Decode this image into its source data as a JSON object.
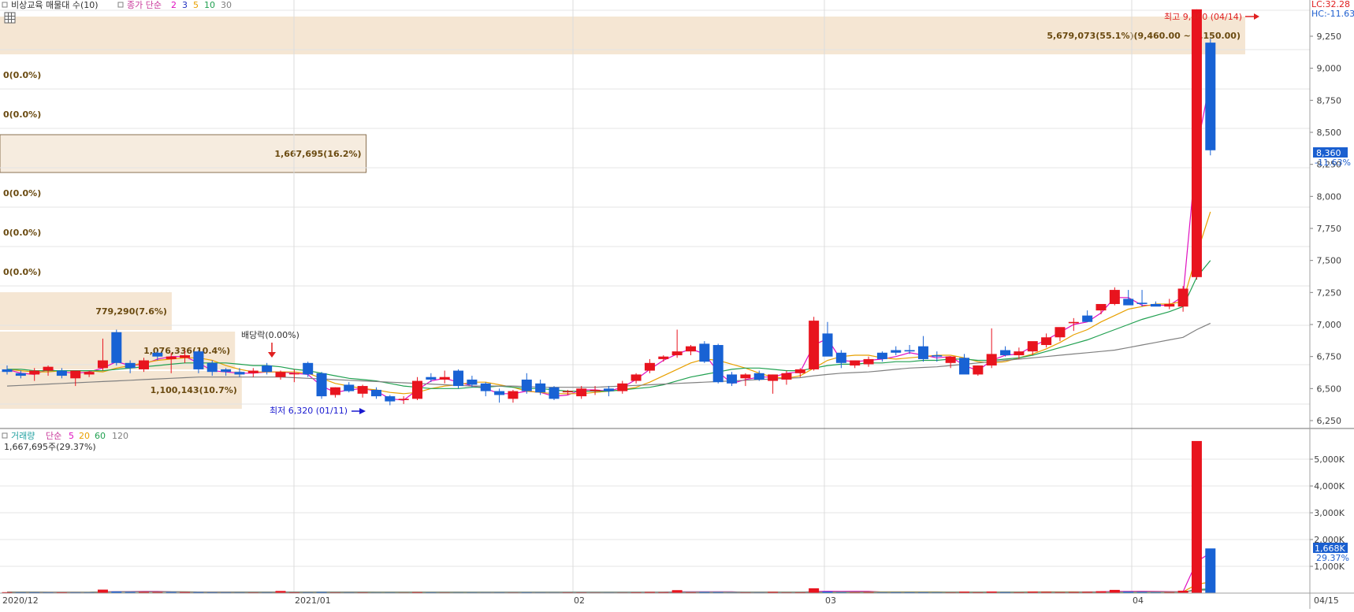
{
  "header": {
    "menu_label": "비상교육 매물대 수(10)",
    "ma_label": "종가 단순",
    "ma_periods": [
      "2",
      "3",
      "5",
      "10",
      "30"
    ],
    "ma_colors": [
      "#e010c0",
      "#2030c0",
      "#e8a000",
      "#20a050",
      "#808080"
    ]
  },
  "top_right": {
    "lc": "LC:32.28",
    "hc": "HC:-11.63"
  },
  "price_axis": {
    "ticks": [
      "9,250",
      "9,000",
      "8,750",
      "8,500",
      "8,250",
      "8,000",
      "7,750",
      "7,500",
      "7,250",
      "7,000",
      "6,750",
      "6,500",
      "6,250"
    ]
  },
  "price_tag": {
    "value": "8,360",
    "change": "-11.63%"
  },
  "volume_profile": {
    "labels": [
      "5,679,073(55.1%)(9,460.00 ~ 9,150.00)",
      "0(0.0%)",
      "0(0.0%)",
      "1,667,695(16.2%)",
      "0(0.0%)",
      "0(0.0%)",
      "0(0.0%)",
      "779,290(7.6%)",
      "1,076,336(10.4%)",
      "1,100,143(10.7%)"
    ],
    "fractions": [
      0.551,
      0,
      0,
      0.162,
      0,
      0,
      0,
      0.076,
      0.104,
      0.107
    ],
    "color": "#f5e6d3"
  },
  "annotations": {
    "high": "최고 9,460 (04/14)",
    "low": "최저 6,320 (01/11)",
    "dividend": "배당락(0.00%)"
  },
  "volume_panel": {
    "title": "거래량",
    "ma_label": "단순",
    "ma_periods": [
      "5",
      "20",
      "60",
      "120"
    ],
    "ma_colors": [
      "#e010c0",
      "#e8a000",
      "#20a050",
      "#808080"
    ],
    "info": "1,667,695주(29.37%)",
    "axis_ticks": [
      "5,000K",
      "4,000K",
      "3,000K",
      "2,000K",
      "1,000K"
    ],
    "tag_value": "1,668K",
    "tag_pct": "29.37%"
  },
  "x_axis": {
    "labels": [
      "2020/12",
      "2021/01",
      "02",
      "03",
      "04",
      "04/15"
    ]
  },
  "chart_data": {
    "type": "candlestick",
    "title": "비상교육",
    "y_axis": {
      "ylim": [
        6200,
        9500
      ],
      "ticks": [
        9250,
        9000,
        8750,
        8500,
        8250,
        8000,
        7750,
        7500,
        7250,
        7000,
        6750,
        6500,
        6250
      ]
    },
    "high_point": {
      "date": "04/14",
      "value": 9460
    },
    "low_point": {
      "date": "01/11",
      "value": 6320
    },
    "last": {
      "date": "04/15",
      "close": 8360,
      "change_pct": -11.63
    },
    "candles": [
      [
        6650,
        6680,
        6610,
        6630
      ],
      [
        6620,
        6640,
        6580,
        6600
      ],
      [
        6610,
        6660,
        6560,
        6640
      ],
      [
        6640,
        6680,
        6600,
        6670
      ],
      [
        6640,
        6660,
        6580,
        6600
      ],
      [
        6580,
        6610,
        6520,
        6640
      ],
      [
        6610,
        6640,
        6590,
        6630
      ],
      [
        6660,
        6890,
        6640,
        6720
      ],
      [
        6940,
        6960,
        6680,
        6700
      ],
      [
        6700,
        6720,
        6620,
        6660
      ],
      [
        6650,
        6740,
        6630,
        6720
      ],
      [
        6780,
        6790,
        6720,
        6750
      ],
      [
        6730,
        6780,
        6620,
        6750
      ],
      [
        6740,
        6800,
        6700,
        6760
      ],
      [
        6790,
        6800,
        6620,
        6650
      ],
      [
        6700,
        6720,
        6600,
        6630
      ],
      [
        6650,
        6660,
        6600,
        6630
      ],
      [
        6630,
        6660,
        6590,
        6610
      ],
      [
        6620,
        6660,
        6590,
        6640
      ],
      [
        6680,
        6700,
        6610,
        6630
      ],
      [
        6590,
        6640,
        6570,
        6630
      ],
      [
        6620,
        6650,
        6550,
        6620
      ],
      [
        6700,
        6710,
        6590,
        6610
      ],
      [
        6620,
        6630,
        6420,
        6440
      ],
      [
        6450,
        6510,
        6430,
        6510
      ],
      [
        6530,
        6550,
        6470,
        6480
      ],
      [
        6460,
        6530,
        6430,
        6520
      ],
      [
        6490,
        6510,
        6420,
        6440
      ],
      [
        6440,
        6450,
        6370,
        6400
      ],
      [
        6410,
        6440,
        6380,
        6420
      ],
      [
        6420,
        6590,
        6410,
        6560
      ],
      [
        6590,
        6620,
        6550,
        6570
      ],
      [
        6570,
        6640,
        6540,
        6590
      ],
      [
        6640,
        6650,
        6500,
        6520
      ],
      [
        6570,
        6600,
        6510,
        6530
      ],
      [
        6540,
        6550,
        6440,
        6480
      ],
      [
        6480,
        6500,
        6390,
        6450
      ],
      [
        6420,
        6490,
        6390,
        6480
      ],
      [
        6570,
        6620,
        6460,
        6480
      ],
      [
        6540,
        6570,
        6450,
        6470
      ],
      [
        6510,
        6520,
        6410,
        6420
      ],
      [
        6480,
        6490,
        6450,
        6480
      ],
      [
        6440,
        6520,
        6420,
        6500
      ],
      [
        6480,
        6520,
        6450,
        6490
      ],
      [
        6500,
        6520,
        6440,
        6480
      ],
      [
        6480,
        6560,
        6460,
        6540
      ],
      [
        6560,
        6620,
        6540,
        6610
      ],
      [
        6640,
        6730,
        6620,
        6700
      ],
      [
        6730,
        6760,
        6710,
        6750
      ],
      [
        6760,
        6960,
        6740,
        6790
      ],
      [
        6790,
        6840,
        6760,
        6830
      ],
      [
        6850,
        6870,
        6700,
        6710
      ],
      [
        6840,
        6850,
        6540,
        6550
      ],
      [
        6610,
        6630,
        6520,
        6540
      ],
      [
        6580,
        6620,
        6520,
        6610
      ],
      [
        6620,
        6640,
        6560,
        6570
      ],
      [
        6560,
        6610,
        6460,
        6610
      ],
      [
        6570,
        6640,
        6530,
        6620
      ],
      [
        6620,
        6660,
        6590,
        6650
      ],
      [
        6650,
        7060,
        6640,
        7030
      ],
      [
        6930,
        7020,
        6770,
        6750
      ],
      [
        6780,
        6800,
        6660,
        6700
      ],
      [
        6680,
        6720,
        6660,
        6720
      ],
      [
        6690,
        6750,
        6670,
        6730
      ],
      [
        6780,
        6790,
        6710,
        6730
      ],
      [
        6800,
        6830,
        6760,
        6780
      ],
      [
        6800,
        6840,
        6770,
        6790
      ],
      [
        6830,
        6910,
        6710,
        6730
      ],
      [
        6760,
        6790,
        6710,
        6750
      ],
      [
        6700,
        6740,
        6660,
        6750
      ],
      [
        6740,
        6770,
        6630,
        6610
      ],
      [
        6610,
        6680,
        6600,
        6680
      ],
      [
        6680,
        6970,
        6660,
        6770
      ],
      [
        6800,
        6830,
        6750,
        6760
      ],
      [
        6760,
        6820,
        6730,
        6790
      ],
      [
        6790,
        6850,
        6760,
        6870
      ],
      [
        6840,
        6930,
        6820,
        6900
      ],
      [
        6900,
        6940,
        6870,
        6980
      ],
      [
        7010,
        7050,
        6950,
        7020
      ],
      [
        7070,
        7110,
        7060,
        7020
      ],
      [
        7110,
        7150,
        7080,
        7160
      ],
      [
        7160,
        7290,
        7150,
        7270
      ],
      [
        7200,
        7270,
        7170,
        7150
      ],
      [
        7170,
        7270,
        7140,
        7160
      ],
      [
        7160,
        7180,
        7150,
        7140
      ],
      [
        7140,
        7200,
        7120,
        7160
      ],
      [
        7140,
        7300,
        7100,
        7280
      ],
      [
        7370,
        9460,
        7350,
        9460
      ],
      [
        9200,
        9230,
        8320,
        8360
      ]
    ],
    "ma_lines": [
      {
        "name": "2",
        "color": "#e010c0",
        "values": [
          6650,
          6620,
          6610,
          6650,
          6630,
          6620,
          6630,
          6660,
          6710,
          6680,
          6690,
          6730,
          6750,
          6750,
          6700,
          6640,
          6630,
          6620,
          6620,
          6630,
          6630,
          6620,
          6610,
          6520,
          6470,
          6490,
          6500,
          6480,
          6420,
          6410,
          6490,
          6560,
          6580,
          6550,
          6520,
          6500,
          6460,
          6460,
          6480,
          6470,
          6440,
          6450,
          6490,
          6490,
          6480,
          6510,
          6570,
          6650,
          6720,
          6770,
          6810,
          6770,
          6630,
          6540,
          6570,
          6590,
          6590,
          6620,
          6630,
          6840,
          6890,
          6720,
          6710,
          6720,
          6730,
          6750,
          6780,
          6760,
          6740,
          6750,
          6680,
          6640,
          6720,
          6760,
          6770,
          6830,
          6880,
          6940,
          7000,
          7020,
          7090,
          7210,
          7210,
          7150,
          7150,
          7150,
          7220,
          8370,
          8910
        ]
      },
      {
        "name": "5",
        "color": "#e8a000",
        "values": [
          6650,
          6640,
          6630,
          6630,
          6640,
          6640,
          6640,
          6630,
          6660,
          6680,
          6700,
          6720,
          6730,
          6740,
          6740,
          6720,
          6680,
          6650,
          6630,
          6630,
          6630,
          6630,
          6620,
          6580,
          6540,
          6520,
          6500,
          6490,
          6470,
          6460,
          6470,
          6500,
          6520,
          6530,
          6550,
          6550,
          6530,
          6510,
          6480,
          6470,
          6460,
          6460,
          6460,
          6470,
          6480,
          6490,
          6510,
          6550,
          6600,
          6650,
          6700,
          6730,
          6720,
          6690,
          6660,
          6620,
          6590,
          6580,
          6600,
          6660,
          6720,
          6750,
          6760,
          6760,
          6740,
          6730,
          6740,
          6750,
          6760,
          6760,
          6740,
          6710,
          6700,
          6710,
          6740,
          6770,
          6810,
          6860,
          6920,
          6960,
          7020,
          7070,
          7120,
          7140,
          7160,
          7160,
          7180,
          7550,
          7880
        ]
      },
      {
        "name": "10",
        "color": "#20a050",
        "values": [
          6650,
          6650,
          6640,
          6640,
          6640,
          6640,
          6640,
          6640,
          6650,
          6660,
          6670,
          6680,
          6690,
          6700,
          6700,
          6700,
          6700,
          6690,
          6680,
          6680,
          6670,
          6650,
          6640,
          6620,
          6600,
          6580,
          6570,
          6560,
          6540,
          6520,
          6510,
          6500,
          6500,
          6500,
          6510,
          6510,
          6520,
          6510,
          6500,
          6500,
          6490,
          6480,
          6480,
          6480,
          6480,
          6490,
          6500,
          6510,
          6530,
          6560,
          6590,
          6610,
          6630,
          6650,
          6660,
          6660,
          6650,
          6640,
          6640,
          6660,
          6680,
          6690,
          6690,
          6700,
          6700,
          6710,
          6710,
          6720,
          6720,
          6730,
          6730,
          6720,
          6720,
          6730,
          6740,
          6760,
          6790,
          6820,
          6850,
          6880,
          6920,
          6960,
          7000,
          7040,
          7070,
          7100,
          7140,
          7370,
          7500
        ]
      },
      {
        "name": "30",
        "color": "#808080",
        "values": [
          6520,
          6525,
          6530,
          6535,
          6540,
          6545,
          6550,
          6555,
          6560,
          6565,
          6570,
          6575,
          6580,
          6585,
          6590,
          6590,
          6590,
          6590,
          6590,
          6590,
          6590,
          6585,
          6580,
          6575,
          6570,
          6565,
          6560,
          6555,
          6550,
          6545,
          6540,
          6535,
          6530,
          6525,
          6520,
          6520,
          6520,
          6520,
          6515,
          6510,
          6510,
          6510,
          6510,
          6510,
          6515,
          6520,
          6525,
          6530,
          6535,
          6540,
          6545,
          6550,
          6555,
          6560,
          6565,
          6570,
          6575,
          6580,
          6585,
          6600,
          6610,
          6620,
          6625,
          6630,
          6640,
          6650,
          6660,
          6665,
          6670,
          6680,
          6690,
          6700,
          6710,
          6720,
          6730,
          6740,
          6750,
          6760,
          6770,
          6780,
          6790,
          6800,
          6820,
          6840,
          6860,
          6880,
          6900,
          6960,
          7010
        ]
      }
    ],
    "volume": [
      [
        35000,
        "up"
      ],
      [
        28000,
        "down"
      ],
      [
        30000,
        "down"
      ],
      [
        27000,
        "down"
      ],
      [
        30000,
        "up"
      ],
      [
        26000,
        "down"
      ],
      [
        25000,
        "down"
      ],
      [
        130000,
        "up"
      ],
      [
        60000,
        "down"
      ],
      [
        45000,
        "down"
      ],
      [
        45000,
        "up"
      ],
      [
        40000,
        "up"
      ],
      [
        42000,
        "down"
      ],
      [
        38000,
        "up"
      ],
      [
        35000,
        "down"
      ],
      [
        28000,
        "down"
      ],
      [
        26000,
        "down"
      ],
      [
        24000,
        "down"
      ],
      [
        25000,
        "up"
      ],
      [
        24000,
        "down"
      ],
      [
        80000,
        "up"
      ],
      [
        30000,
        "up"
      ],
      [
        25000,
        "down"
      ],
      [
        38000,
        "down"
      ],
      [
        25000,
        "up"
      ],
      [
        22000,
        "down"
      ],
      [
        25000,
        "up"
      ],
      [
        20000,
        "down"
      ],
      [
        22000,
        "down"
      ],
      [
        20000,
        "up"
      ],
      [
        35000,
        "up"
      ],
      [
        25000,
        "down"
      ],
      [
        22000,
        "up"
      ],
      [
        20000,
        "down"
      ],
      [
        22000,
        "down"
      ],
      [
        20000,
        "down"
      ],
      [
        22000,
        "down"
      ],
      [
        20000,
        "up"
      ],
      [
        25000,
        "down"
      ],
      [
        20000,
        "down"
      ],
      [
        18000,
        "down"
      ],
      [
        25000,
        "up"
      ],
      [
        25000,
        "up"
      ],
      [
        20000,
        "up"
      ],
      [
        18000,
        "down"
      ],
      [
        20000,
        "up"
      ],
      [
        30000,
        "up"
      ],
      [
        42000,
        "up"
      ],
      [
        35000,
        "up"
      ],
      [
        110000,
        "up"
      ],
      [
        30000,
        "up"
      ],
      [
        40000,
        "down"
      ],
      [
        35000,
        "down"
      ],
      [
        20000,
        "down"
      ],
      [
        25000,
        "up"
      ],
      [
        20000,
        "down"
      ],
      [
        45000,
        "up"
      ],
      [
        25000,
        "up"
      ],
      [
        30000,
        "up"
      ],
      [
        180000,
        "up"
      ],
      [
        60000,
        "down"
      ],
      [
        35000,
        "down"
      ],
      [
        30000,
        "up"
      ],
      [
        35000,
        "up"
      ],
      [
        25000,
        "down"
      ],
      [
        30000,
        "down"
      ],
      [
        30000,
        "down"
      ],
      [
        30000,
        "down"
      ],
      [
        25000,
        "down"
      ],
      [
        25000,
        "up"
      ],
      [
        55000,
        "up"
      ],
      [
        30000,
        "up"
      ],
      [
        60000,
        "up"
      ],
      [
        35000,
        "down"
      ],
      [
        30000,
        "up"
      ],
      [
        55000,
        "up"
      ],
      [
        45000,
        "up"
      ],
      [
        35000,
        "up"
      ],
      [
        40000,
        "up"
      ],
      [
        45000,
        "up"
      ],
      [
        70000,
        "up"
      ],
      [
        120000,
        "up"
      ],
      [
        55000,
        "down"
      ],
      [
        45000,
        "down"
      ],
      [
        30000,
        "down"
      ],
      [
        35000,
        "up"
      ],
      [
        90000,
        "up"
      ],
      [
        5679073,
        "up"
      ],
      [
        1667695,
        "down"
      ]
    ]
  }
}
